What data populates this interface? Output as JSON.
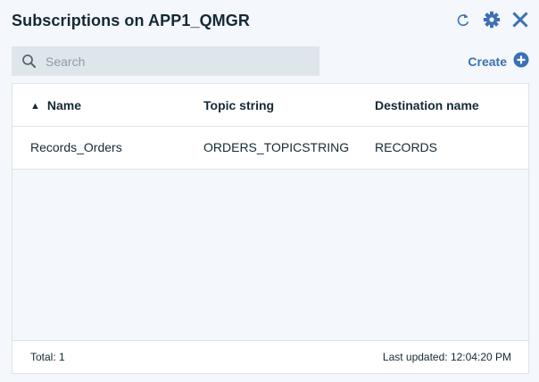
{
  "header": {
    "title": "Subscriptions on APP1_QMGR",
    "icons": [
      "refresh-icon",
      "gear-icon",
      "close-icon"
    ],
    "accent_color": "#3d70b2"
  },
  "toolbar": {
    "search_placeholder": "Search",
    "search_value": "",
    "create_label": "Create"
  },
  "table": {
    "columns": [
      {
        "label": "Name",
        "sort": "ascending"
      },
      {
        "label": "Topic string"
      },
      {
        "label": "Destination name"
      }
    ],
    "rows": [
      {
        "name": "Records_Orders",
        "topic_string": "ORDERS_TOPICSTRING",
        "destination_name": "RECORDS"
      }
    ]
  },
  "footer": {
    "total": "Total: 1",
    "last_updated": "Last updated: 12:04:20 PM"
  }
}
